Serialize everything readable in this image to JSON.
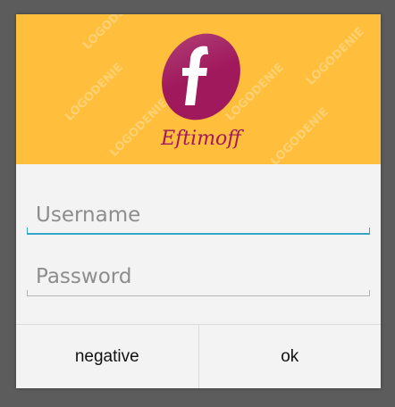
{
  "dialog": {
    "brand": {
      "name": "Eftimoff",
      "watermark": "LOGODENIE",
      "colors": {
        "header_bg": "#ffbf3c",
        "logo_primary": "#a0195c",
        "logo_text": "#a0195c"
      }
    },
    "fields": {
      "username_placeholder": "Username",
      "password_placeholder": "Password",
      "focused_color": "#33a6c7",
      "unfocused_color": "#b4b4b4"
    },
    "buttons": {
      "negative_label": "negative",
      "positive_label": "ok"
    }
  }
}
